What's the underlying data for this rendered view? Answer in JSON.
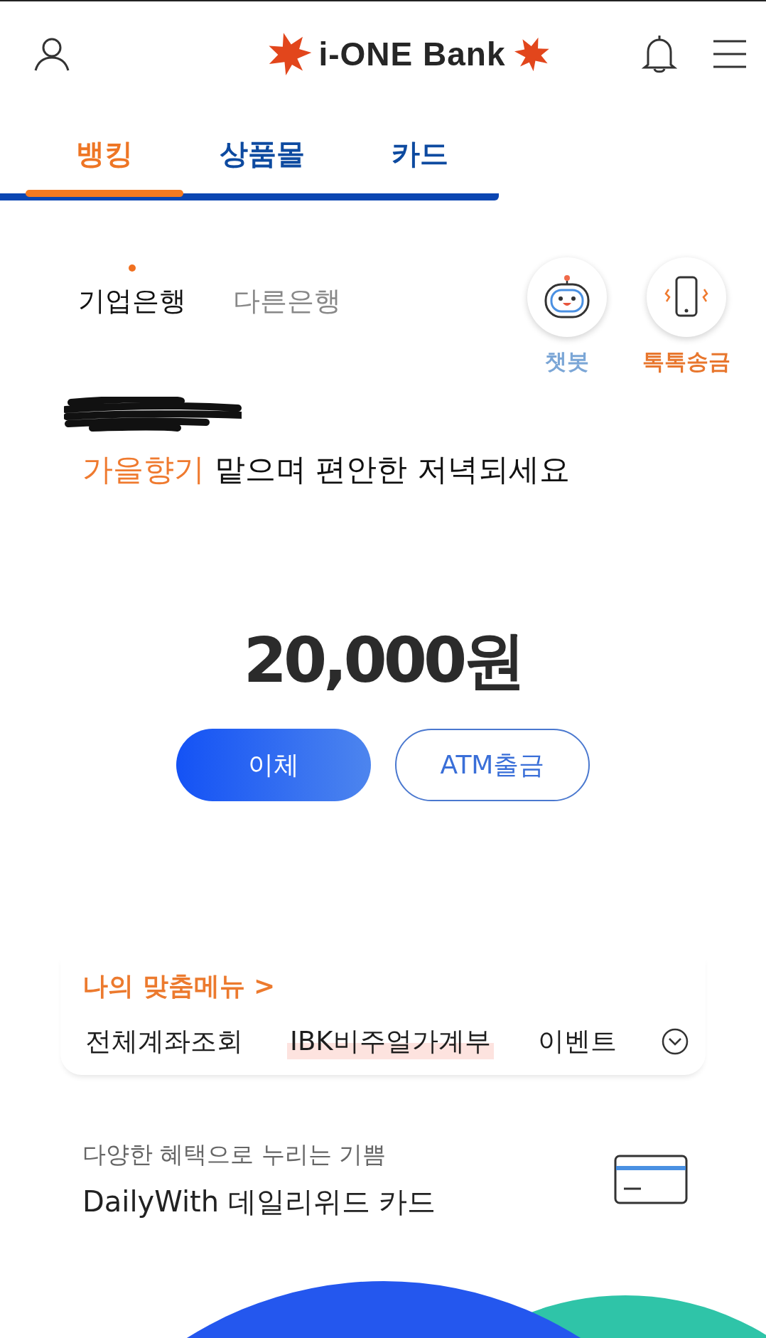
{
  "header": {
    "logo": "i-ONE Bank"
  },
  "tabs": [
    {
      "label": "뱅킹",
      "selected": true
    },
    {
      "label": "상품몰",
      "selected": false
    },
    {
      "label": "카드",
      "selected": false
    }
  ],
  "bank_tabs": [
    {
      "label": "기업은행",
      "selected": true
    },
    {
      "label": "다른은행",
      "selected": false
    }
  ],
  "quick_actions": [
    {
      "kind": "chatbot",
      "label": "챗봇",
      "color": "#7ba6d6"
    },
    {
      "kind": "transfer",
      "label": "톡톡송금",
      "color": "#e8772e"
    }
  ],
  "greeting": {
    "highlight": "가을향기",
    "text": "맡으며 편안한 저녁되세요"
  },
  "balance": "20,000원",
  "actions": [
    {
      "label": "이체",
      "kind": "primary"
    },
    {
      "label": "ATM출금",
      "kind": "outline"
    }
  ],
  "my_menu": {
    "title": "나의 맞춤메뉴 >",
    "items": [
      {
        "label": "전체계좌조회",
        "highlighted": false
      },
      {
        "label": "IBK비주얼가계부",
        "highlighted": true
      },
      {
        "label": "이벤트",
        "highlighted": false
      }
    ],
    "expanded": false
  },
  "promo": {
    "subtitle": "다양한 혜택으로 누리는 기쁨",
    "title": "DailyWith 데일리위드 카드"
  }
}
